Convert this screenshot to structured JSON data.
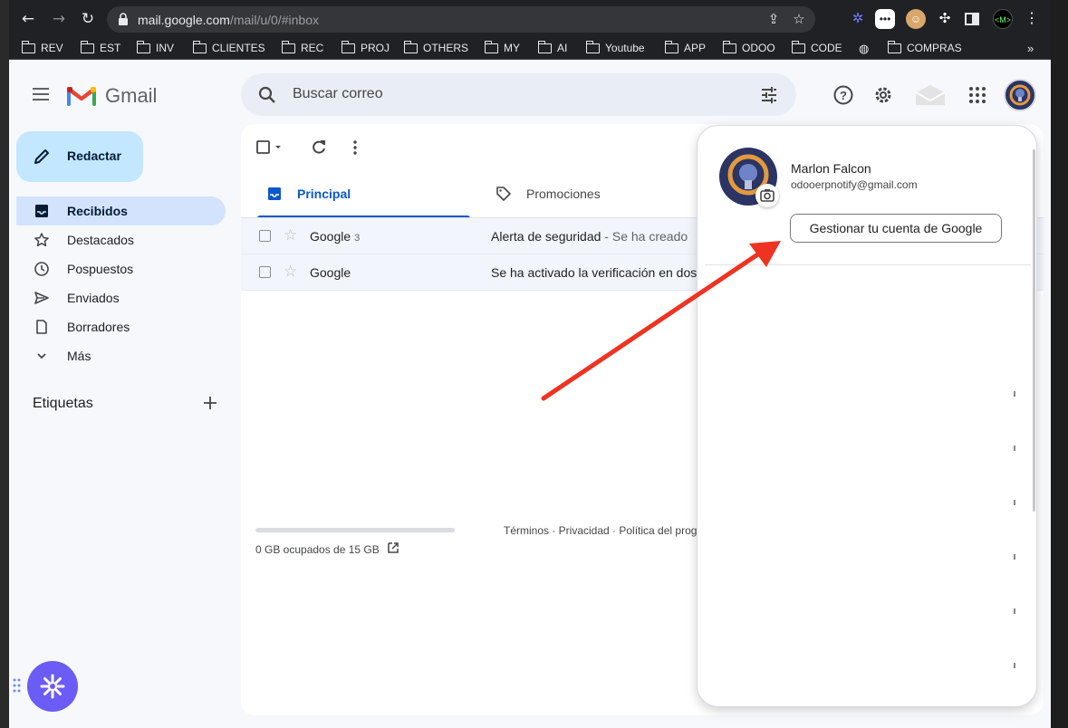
{
  "browser": {
    "url_host": "mail.google.com",
    "url_path": "/mail/u/0/#inbox",
    "bookmarks": [
      "REV",
      "EST",
      "INV",
      "CLIENTES",
      "REC",
      "PROJ",
      "OTHERS",
      "MY",
      "AI",
      "Youtube",
      "APP",
      "ODOO",
      "CODE",
      "",
      "COMPRAS"
    ]
  },
  "gmail": {
    "app_name": "Gmail",
    "search_placeholder": "Buscar correo",
    "compose_label": "Redactar",
    "nav": [
      {
        "label": "Recibidos",
        "icon": "inbox-icon",
        "active": true
      },
      {
        "label": "Destacados",
        "icon": "star-icon",
        "active": false
      },
      {
        "label": "Pospuestos",
        "icon": "clock-icon",
        "active": false
      },
      {
        "label": "Enviados",
        "icon": "send-icon",
        "active": false
      },
      {
        "label": "Borradores",
        "icon": "draft-icon",
        "active": false
      },
      {
        "label": "Más",
        "icon": "chevron-down-icon",
        "active": false
      }
    ],
    "labels_title": "Etiquetas",
    "tabs": [
      {
        "label": "Principal",
        "active": true
      },
      {
        "label": "Promociones",
        "active": false
      }
    ],
    "emails": [
      {
        "sender": "Google",
        "count": "3",
        "subject": "Alerta de seguridad",
        "snippet": " - Se ha creado"
      },
      {
        "sender": "Google",
        "count": "",
        "subject": "Se ha activado la verificación en dos",
        "snippet": ""
      }
    ],
    "storage_text": "0 GB ocupados de 15 GB",
    "storage_used_fraction": 0.0,
    "footer": "Términos · Privacidad · Política del prog"
  },
  "account": {
    "name": "Marlon Falcon",
    "email": "odooerpnotify@gmail.com",
    "manage_label": "Gestionar tu cuenta de Google"
  },
  "colors": {
    "accent_blue": "#0b57d0",
    "compose_bg": "#c2e7ff",
    "nav_active_bg": "#d3e3fd",
    "arrow_red": "#ee3322",
    "fab_purple": "#6b5cf6"
  }
}
